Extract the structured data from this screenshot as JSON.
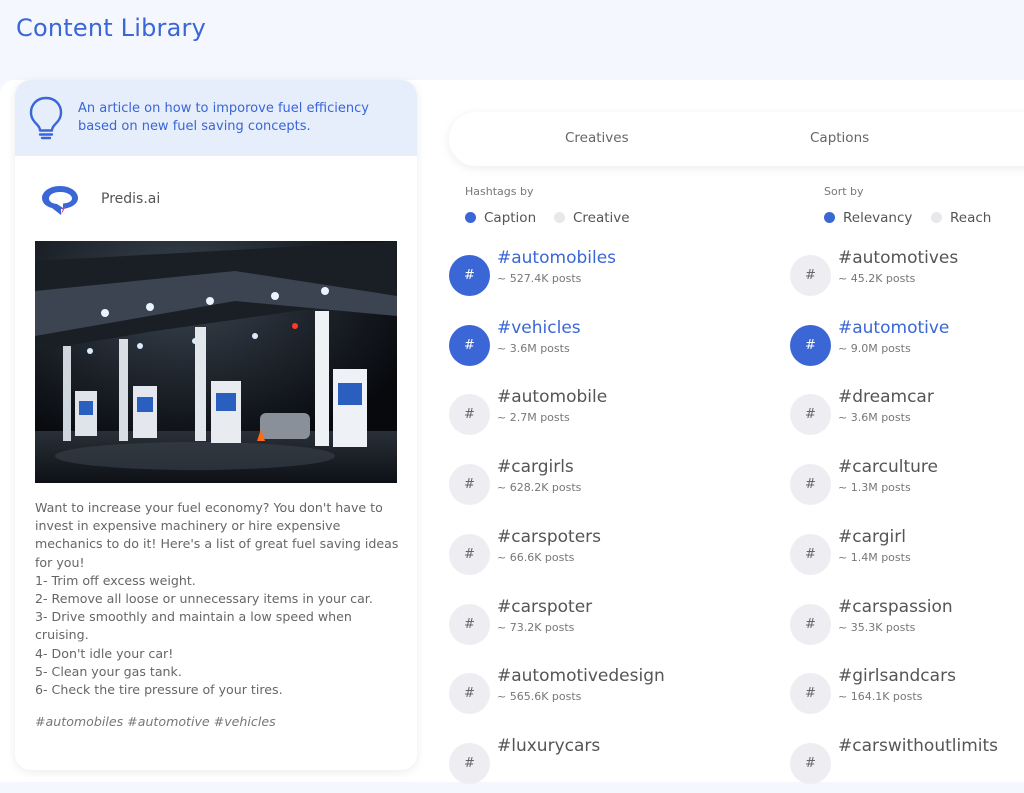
{
  "page": {
    "title": "Content Library"
  },
  "colors": {
    "accent": "#3a66d6",
    "banner": "#e6edfb",
    "icon_bg": "#eeeef2"
  },
  "post": {
    "idea": "An article on how to imporove fuel efficiency based on new fuel saving concepts.",
    "brand": "Predis.ai",
    "image": "gas-station-night-photo",
    "body": "Want to increase your fuel economy? You don't have to invest in expensive machinery or hire expensive mechanics to do it! Here's a list of great fuel saving ideas for you!\n1- Trim off excess weight.\n2- Remove all loose or unnecessary items in your car.\n3- Drive smoothly and maintain a low speed when cruising.\n4- Don't idle your car!\n5- Clean your gas tank.\n6- Check the tire pressure of your tires.",
    "hashtags": "#automobiles #automotive #vehicles"
  },
  "tabs": [
    {
      "label": "Creatives"
    },
    {
      "label": "Captions"
    }
  ],
  "filters": {
    "hashtags_by": {
      "label": "Hashtags by",
      "options": [
        "Caption",
        "Creative"
      ],
      "selected": "Caption"
    },
    "sort_by": {
      "label": "Sort by",
      "options": [
        "Relevancy",
        "Reach"
      ],
      "selected": "Relevancy"
    }
  },
  "hashtags": {
    "icon_symbol": "#",
    "left": [
      {
        "tag": "#automobiles",
        "count": "~ 527.4K posts",
        "selected": true
      },
      {
        "tag": "#vehicles",
        "count": "~ 3.6M posts",
        "selected": true
      },
      {
        "tag": "#automobile",
        "count": "~ 2.7M posts",
        "selected": false
      },
      {
        "tag": "#cargirls",
        "count": "~ 628.2K posts",
        "selected": false
      },
      {
        "tag": "#carspoters",
        "count": "~ 66.6K posts",
        "selected": false
      },
      {
        "tag": "#carspoter",
        "count": "~ 73.2K posts",
        "selected": false
      },
      {
        "tag": "#automotivedesign",
        "count": "~ 565.6K posts",
        "selected": false
      },
      {
        "tag": "#luxurycars",
        "count": "",
        "selected": false
      }
    ],
    "right": [
      {
        "tag": "#automotives",
        "count": "~ 45.2K posts",
        "selected": false
      },
      {
        "tag": "#automotive",
        "count": "~ 9.0M posts",
        "selected": true
      },
      {
        "tag": "#dreamcar",
        "count": "~ 3.6M posts",
        "selected": false
      },
      {
        "tag": "#carculture",
        "count": "~ 1.3M posts",
        "selected": false
      },
      {
        "tag": "#cargirl",
        "count": "~ 1.4M posts",
        "selected": false
      },
      {
        "tag": "#carspassion",
        "count": "~ 35.3K posts",
        "selected": false
      },
      {
        "tag": "#girlsandcars",
        "count": "~ 164.1K posts",
        "selected": false
      },
      {
        "tag": "#carswithoutlimits",
        "count": "",
        "selected": false
      }
    ]
  }
}
